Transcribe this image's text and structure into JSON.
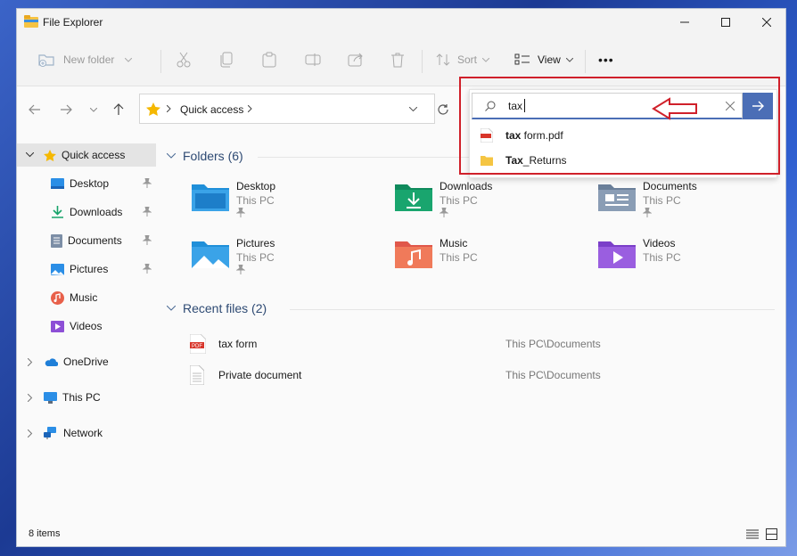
{
  "window": {
    "title": "File Explorer"
  },
  "toolbar": {
    "new_folder": "New folder",
    "sort": "Sort",
    "view": "View",
    "more": "•••"
  },
  "address": {
    "location": "Quick access"
  },
  "search": {
    "query": "tax",
    "suggestions": [
      {
        "prefix": "tax",
        "rest": " form.pdf",
        "icon": "pdf-icon"
      },
      {
        "prefix": "Tax",
        "rest": "_Returns",
        "icon": "folder-icon"
      }
    ]
  },
  "sidebar": {
    "quick_access": "Quick access",
    "items": [
      {
        "label": "Desktop",
        "icon": "desktop-icon"
      },
      {
        "label": "Downloads",
        "icon": "downloads-icon"
      },
      {
        "label": "Documents",
        "icon": "documents-icon"
      },
      {
        "label": "Pictures",
        "icon": "pictures-icon"
      },
      {
        "label": "Music",
        "icon": "music-icon"
      },
      {
        "label": "Videos",
        "icon": "videos-icon"
      }
    ],
    "onedrive": "OneDrive",
    "thispc": "This PC",
    "network": "Network"
  },
  "folders": {
    "heading": "Folders (6)",
    "items": [
      {
        "name": "Desktop",
        "location": "This PC",
        "pinned": true
      },
      {
        "name": "Downloads",
        "location": "This PC",
        "pinned": true
      },
      {
        "name": "Documents",
        "location": "This PC",
        "pinned": true
      },
      {
        "name": "Pictures",
        "location": "This PC",
        "pinned": true
      },
      {
        "name": "Music",
        "location": "This PC",
        "pinned": false
      },
      {
        "name": "Videos",
        "location": "This PC",
        "pinned": false
      }
    ]
  },
  "recent": {
    "heading": "Recent files (2)",
    "items": [
      {
        "name": "tax form",
        "path": "This PC\\Documents",
        "icon": "pdf-icon"
      },
      {
        "name": "Private document",
        "path": "This PC\\Documents",
        "icon": "document-icon"
      }
    ]
  },
  "status": {
    "count": "8 items"
  },
  "colors": {
    "accent": "#4b6eb6",
    "highlight_box": "#d0202a",
    "sidebar_selected": "#e4e4e4"
  }
}
